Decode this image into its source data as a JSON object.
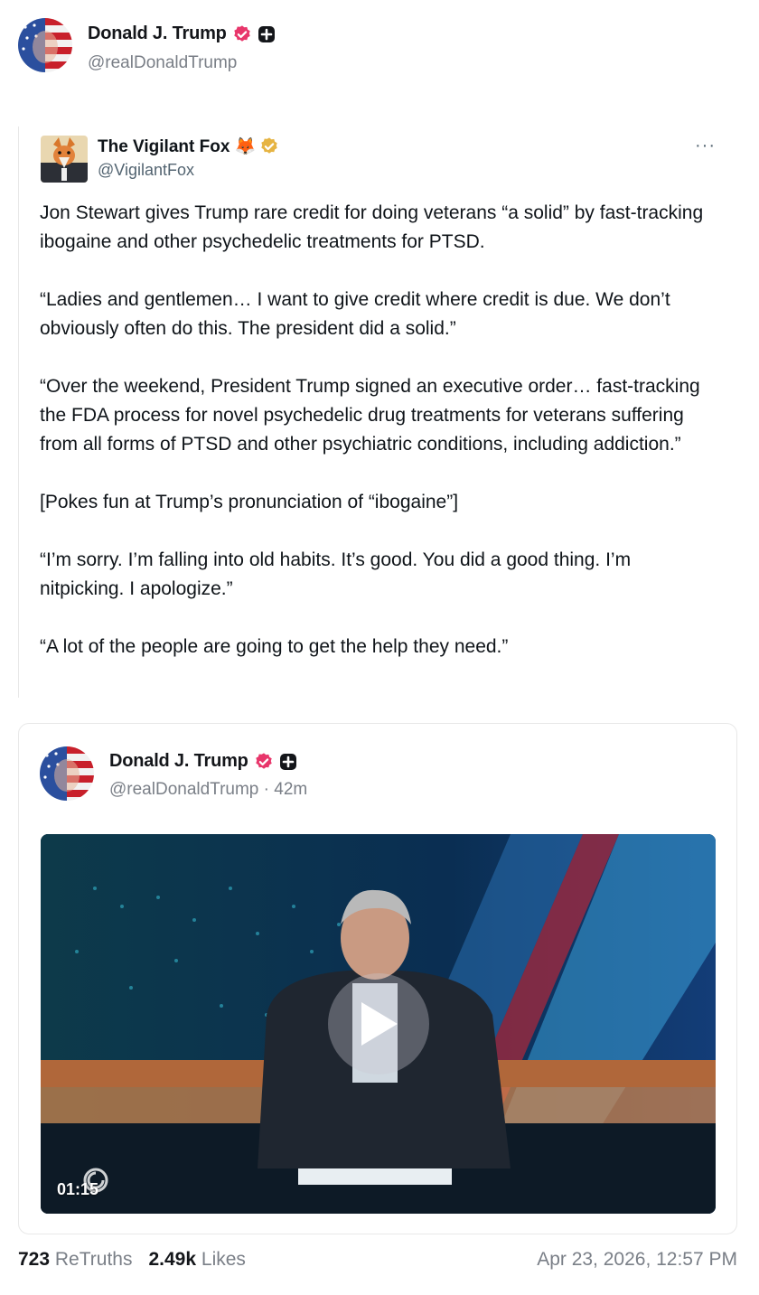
{
  "post": {
    "author_name": "Donald J. Trump",
    "author_handle": "@realDonaldTrump",
    "avatar_icon": "flag-portrait-avatar",
    "badges": [
      "verified-badge-icon",
      "plus-badge-icon"
    ]
  },
  "quoted_x_post": {
    "author_name": "The Vigilant Fox 🦊",
    "author_handle": "@VigilantFox",
    "more_label": "···",
    "paragraphs": [
      "Jon Stewart gives Trump rare credit for doing veterans “a solid” by fast-tracking ibogaine and other psychedelic treatments for PTSD.",
      "“Ladies and gentlemen… I want to give credit where credit is due. We don’t obviously often do this. The president did a solid.”",
      "“Over the weekend, President Trump signed an executive order… fast-tracking the FDA process for novel psychedelic drug treatments for veterans suffering from all forms of PTSD and other psychiatric conditions, including addiction.”",
      "[Pokes fun at Trump’s pronunciation of “ibogaine”]",
      "“I’m sorry. I’m falling into old habits. It’s good. You did a good thing. I’m nitpicking. I apologize.”",
      "“A lot of the people are going to get the help they need.”"
    ]
  },
  "embedded_truth": {
    "author_name": "Donald J. Trump",
    "author_handle": "@realDonaldTrump",
    "separator": "·",
    "age": "42m",
    "video": {
      "duration": "01:15",
      "play_icon": "play-icon"
    }
  },
  "footer": {
    "retruths_count": "723",
    "retruths_label": "ReTruths",
    "likes_count": "2.49k",
    "likes_label": "Likes",
    "timestamp": "Apr 23, 2026, 12:57 PM"
  },
  "colors": {
    "verified_badge": "#e8366b",
    "gold_badge": "#e6b443",
    "muted_text": "#7a7f87"
  }
}
